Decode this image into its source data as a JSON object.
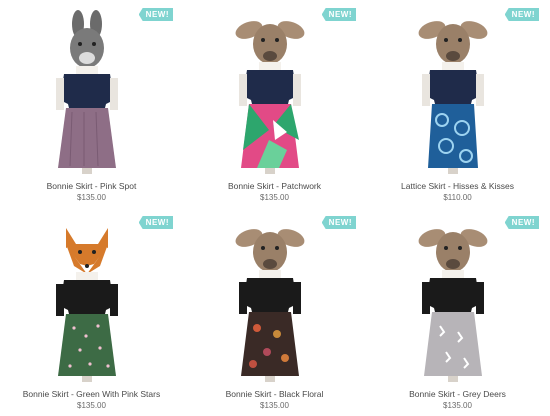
{
  "products": [
    {
      "name": "Bonnie Skirt - Pink Spot",
      "price": "$135.00",
      "badge": "NEW!",
      "head": "rabbit",
      "top_color": "#1f2b4a",
      "skirt_color": "#8e6e86",
      "icon": "rabbit-icon"
    },
    {
      "name": "Bonnie Skirt - Patchwork",
      "price": "$135.00",
      "badge": "NEW!",
      "head": "deer",
      "top_color": "#1f2b4a",
      "skirt_color": "#e24a86",
      "icon": "deer-icon"
    },
    {
      "name": "Lattice Skirt - Hisses & Kisses",
      "price": "$110.00",
      "badge": "NEW!",
      "head": "deer",
      "top_color": "#1f2b4a",
      "skirt_color": "#1f5f9a",
      "icon": "deer-icon"
    },
    {
      "name": "Bonnie Skirt - Green With Pink Stars",
      "price": "$135.00",
      "badge": "NEW!",
      "head": "fox",
      "top_color": "#1a1a1a",
      "skirt_color": "#3d6b45",
      "icon": "fox-icon"
    },
    {
      "name": "Bonnie Skirt - Black Floral",
      "price": "$135.00",
      "badge": "NEW!",
      "head": "deer",
      "top_color": "#1a1a1a",
      "skirt_color": "#3a2a26",
      "icon": "deer-icon"
    },
    {
      "name": "Bonnie Skirt - Grey Deers",
      "price": "$135.00",
      "badge": "NEW!",
      "head": "deer",
      "top_color": "#1a1a1a",
      "skirt_color": "#b7b4b8",
      "icon": "deer-icon"
    }
  ]
}
